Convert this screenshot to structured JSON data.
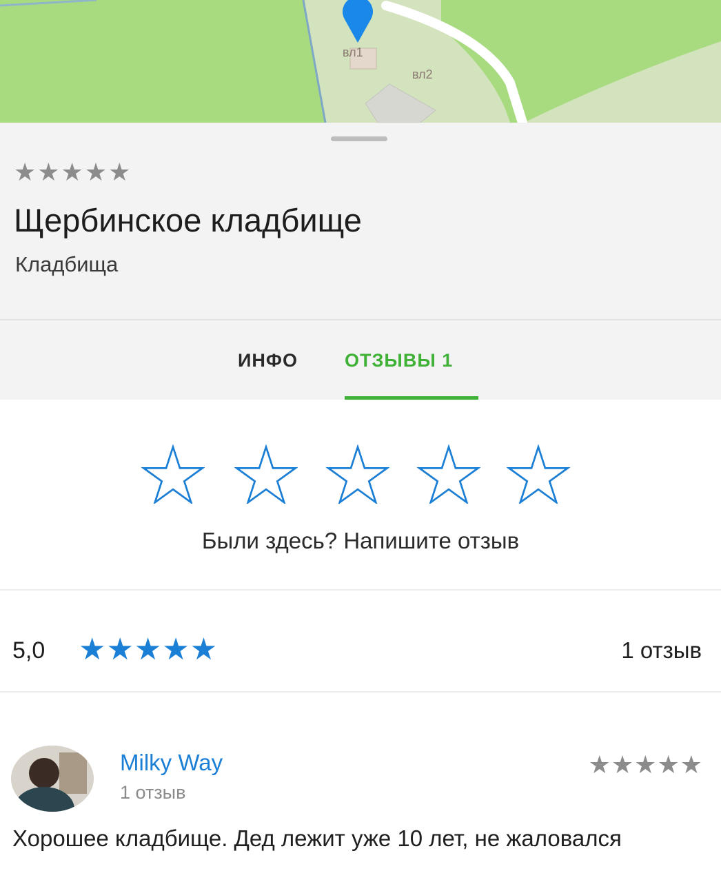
{
  "map": {
    "building_labels": [
      "вл1",
      "вл2"
    ],
    "colors": {
      "park": "#a8db7f",
      "ground": "#d3e3bd",
      "road": "#ffffff",
      "pin": "#1a88e8"
    }
  },
  "place": {
    "stars": "★★★★★",
    "title": "Щербинское кладбище",
    "category": "Кладбища"
  },
  "tabs": [
    {
      "label": "ИНФО",
      "active": false
    },
    {
      "label": "ОТЗЫВЫ 1",
      "active": true
    }
  ],
  "rate_prompt": {
    "star_count": 5,
    "text": "Были здесь? Напишите отзыв"
  },
  "summary": {
    "rating": "5,0",
    "stars": "★★★★★",
    "count_label": "1 отзыв"
  },
  "review": {
    "author": "Milky Way",
    "author_reviews": "1 отзыв",
    "stars": "★★★★★",
    "text": "Хорошее кладбище. Дед лежит уже 10 лет, не жаловался"
  },
  "colors": {
    "accent_green": "#3fb136",
    "accent_blue": "#1b7fd6"
  }
}
